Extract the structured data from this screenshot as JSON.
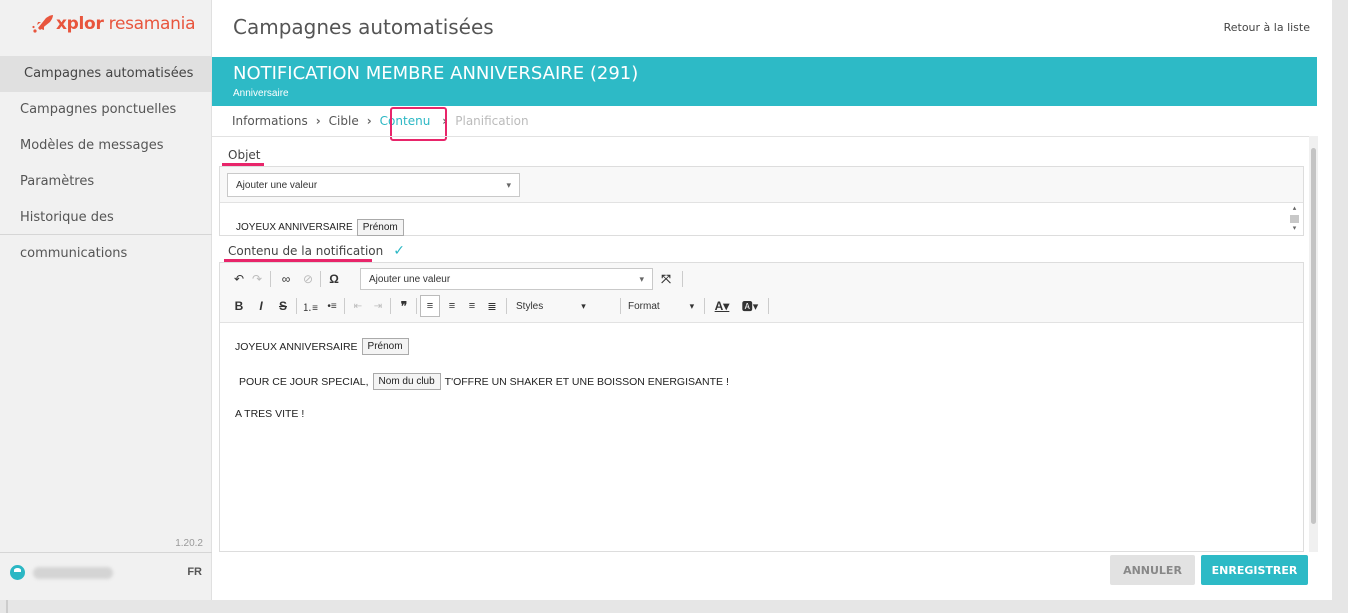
{
  "logo": {
    "brand": "xplor",
    "product": "resamania"
  },
  "sidebar": {
    "items": [
      {
        "label": "Campagnes automatisées"
      },
      {
        "label": "Campagnes ponctuelles"
      },
      {
        "label": "Modèles de messages"
      },
      {
        "label": "Paramètres"
      },
      {
        "label": "Historique des communications"
      }
    ],
    "version": "1.20.2",
    "language": "FR"
  },
  "header": {
    "title": "Campagnes automatisées",
    "back_link": "Retour à la liste"
  },
  "banner": {
    "title": "NOTIFICATION MEMBRE ANNIVERSAIRE (291)",
    "subtitle": "Anniversaire",
    "color": "#2dbac6"
  },
  "breadcrumb": {
    "steps": [
      {
        "label": "Informations"
      },
      {
        "label": "Cible"
      },
      {
        "label": "Contenu"
      },
      {
        "label": "Planification"
      }
    ]
  },
  "objet": {
    "label": "Objet",
    "select_placeholder": "Ajouter une valeur",
    "text": "JOYEUX ANNIVERSAIRE",
    "chip": "Prénom"
  },
  "contenu": {
    "label": "Contenu de la notification",
    "toolbar": {
      "select_placeholder": "Ajouter une valeur",
      "styles_label": "Styles",
      "format_label": "Format"
    },
    "body": {
      "line1_text": "JOYEUX ANNIVERSAIRE",
      "line1_chip": "Prénom",
      "line2_pre": "POUR CE JOUR SPECIAL,",
      "line2_chip": "Nom du club",
      "line2_post": "T'OFFRE UN SHAKER ET UNE BOISSON ENERGISANTE !",
      "line3": "A TRES VITE !"
    }
  },
  "actions": {
    "cancel": "ANNULER",
    "save": "ENREGISTRER"
  },
  "colors": {
    "accent": "#2dbac6",
    "highlight": "#e8256a",
    "brand": "#e8553d"
  }
}
